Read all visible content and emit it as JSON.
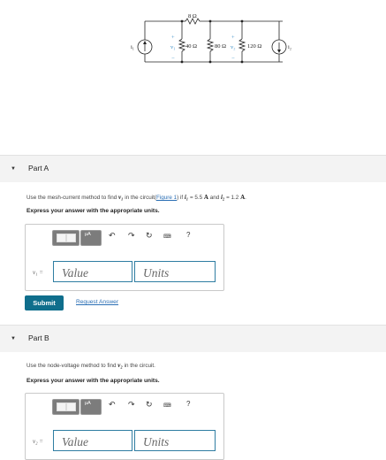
{
  "circuit": {
    "r_series": "8 Ω",
    "r1": "40 Ω",
    "r2": "80 Ω",
    "r3": "120 Ω",
    "source1": "i₁",
    "source2": "i₂",
    "v1_label": "v₁",
    "v2_label": "v₂"
  },
  "part_a": {
    "title": "Part A",
    "question_pre": "Use the mesh-current method to find ",
    "question_var": "v₁",
    "question_mid": " in the circuit(",
    "figure_link": "Figure 1",
    "question_after": ") if ",
    "i1_var": "i₁",
    "i1_val": " = 5.5 ",
    "i1_unit": "A",
    "and": " and ",
    "i2_var": "i₂",
    "i2_val": " = 1.2 ",
    "i2_unit": "A",
    "end": ".",
    "express": "Express your answer with the appropriate units.",
    "lhs": "v₁ =",
    "value_placeholder": "Value",
    "units_placeholder": "Units",
    "submit_label": "Submit",
    "request_answer_label": "Request Answer"
  },
  "part_b": {
    "title": "Part B",
    "question_pre": "Use the node-voltage method to find ",
    "question_var": "v₂",
    "question_post": " in the circuit.",
    "express": "Express your answer with the appropriate units.",
    "lhs": "v₂ =",
    "value_placeholder": "Value",
    "units_placeholder": "Units"
  },
  "toolbar": {
    "mu_label": "μA",
    "help_label": "?"
  },
  "colors": {
    "accent": "#0f6e8c",
    "field_border": "#2f7da2",
    "link": "#2b6fb5",
    "circuit_label": "#3a8ec7"
  }
}
